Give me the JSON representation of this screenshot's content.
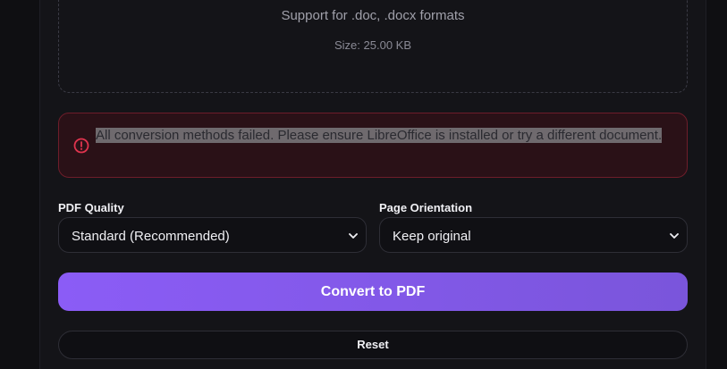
{
  "upload": {
    "formats_text": "Support for .doc, .docx formats",
    "size_text": "Size: 25.00 KB"
  },
  "error": {
    "icon": "alert-circle-icon",
    "message": "All conversion methods failed. Please ensure LibreOffice is installed or try a different document.",
    "accent_color": "#e0344e"
  },
  "settings": {
    "quality": {
      "label": "PDF Quality",
      "selected": "Standard (Recommended)"
    },
    "orientation": {
      "label": "Page Orientation",
      "selected": "Keep original"
    }
  },
  "actions": {
    "convert_label": "Convert to PDF",
    "reset_label": "Reset",
    "accent_color": "#8b5cf6"
  }
}
